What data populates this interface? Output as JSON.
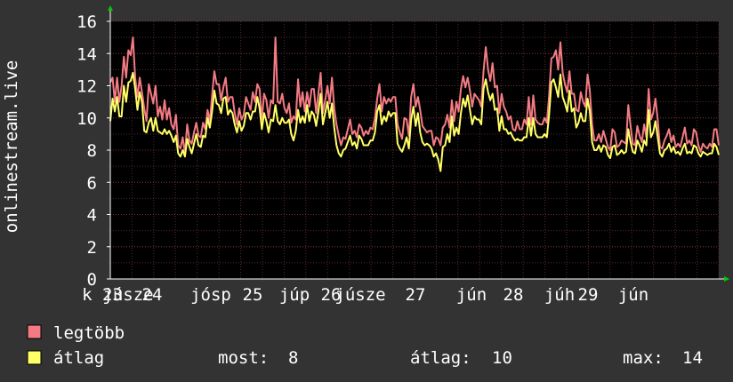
{
  "chart_data": {
    "type": "line",
    "ylabel": "onlinestream.live",
    "ylim": [
      0,
      16
    ],
    "yticks": [
      0,
      2,
      4,
      6,
      8,
      10,
      12,
      14,
      16
    ],
    "grid": true,
    "background_plot": "#000000",
    "background_page": "#333333",
    "x_tick_labels": [
      "k 23",
      "júsze",
      "24",
      "jósp",
      "25",
      "júp",
      "26",
      "júsze",
      "27",
      "jún",
      "28",
      "júh",
      "29",
      "jún"
    ],
    "series": [
      {
        "name": "legtöbb",
        "color": "#f47b84",
        "values": [
          12.2,
          12.5,
          11,
          12.5,
          11,
          12,
          13.8,
          12.5,
          14.2,
          13.9,
          15,
          12.5,
          11.3,
          12.5,
          11.6,
          10.6,
          9.8,
          12.1,
          11.5,
          10.9,
          12,
          10.1,
          10.7,
          9.9,
          11.1,
          9.9,
          10.6,
          9.6,
          9.3,
          10.2,
          8.3,
          8.1,
          8.8,
          7.8,
          9.6,
          8.6,
          8.4,
          9.1,
          9.7,
          8.9,
          8.8,
          9.7,
          9.3,
          10.5,
          9.8,
          11.4,
          12.9,
          12.1,
          12.1,
          11.1,
          11.9,
          12.5,
          11,
          11.3,
          11.3,
          10.3,
          9.6,
          10.6,
          9.9,
          10.2,
          11.3,
          10.9,
          10.5,
          11.6,
          11,
          12.1,
          11.8,
          9.9,
          11.5,
          11.1,
          10,
          11.1,
          10.9,
          15,
          11,
          10.9,
          11.5,
          10.6,
          10.3,
          10.9,
          9.7,
          10.1,
          9.9,
          12.4,
          10.7,
          11.6,
          10.4,
          11.6,
          10.7,
          11.8,
          11.8,
          10.3,
          11.5,
          12.8,
          10.3,
          11.1,
          12,
          10.9,
          12.5,
          10.6,
          9.6,
          8.9,
          8.3,
          8.8,
          8.7,
          9.3,
          9.9,
          9,
          9.2,
          8.8,
          9.6,
          9.4,
          8.9,
          9.2,
          9,
          9.4,
          9.3,
          10,
          11.2,
          12.1,
          10.4,
          11.3,
          10.9,
          11.2,
          11,
          11.3,
          11.3,
          9.6,
          9.1,
          8.7,
          10,
          9.9,
          8.9,
          11.3,
          12.1,
          10.7,
          11.3,
          10.5,
          9.5,
          9.3,
          9.1,
          9.2,
          9.2,
          8.3,
          8.8,
          8.7,
          8.3,
          9.4,
          9.6,
          10.2,
          9.4,
          11.1,
          9.8,
          11,
          10.4,
          11.8,
          12.6,
          11.9,
          12.5,
          11.7,
          10.7,
          11.5,
          11.3,
          11.1,
          10.7,
          12.9,
          14.4,
          13,
          12.3,
          13.4,
          11.9,
          12,
          10.3,
          11.5,
          10.7,
          10.4,
          9.9,
          10.1,
          9.3,
          9.2,
          9.8,
          9.3,
          9.3,
          9.9,
          9.6,
          11.3,
          9.6,
          11.4,
          9.9,
          9.7,
          9.6,
          9.6,
          10,
          9.7,
          11.4,
          13.7,
          13.8,
          14.2,
          13,
          14.7,
          12.8,
          12.1,
          11.6,
          12.9,
          11.5,
          11.5,
          10.5,
          10.4,
          11.6,
          11,
          10.7,
          12.7,
          11.7,
          9.6,
          8.6,
          8.6,
          9,
          8.5,
          9.2,
          8.7,
          8.2,
          8,
          9.3,
          9.1,
          8.2,
          8.3,
          8.6,
          8.5,
          8.4,
          10.8,
          9.5,
          8.4,
          8.3,
          9.5,
          8.9,
          8.5,
          9.6,
          8.8,
          11.8,
          9.9,
          10.3,
          11.2,
          9.9,
          8.2,
          8.1,
          8.6,
          8.9,
          9.3,
          8.5,
          8.9,
          8.2,
          8.4,
          8.2,
          8.8,
          9.4,
          8.4,
          8.6,
          8.3,
          9.3,
          9.1,
          8.3,
          7.9,
          8.4,
          8.2,
          8.1,
          8.4,
          8.2,
          9.3,
          9.3,
          8.3
        ]
      },
      {
        "name": "átlag",
        "color": "#ffff66",
        "values": [
          9.8,
          11.2,
          10.4,
          11.3,
          10.1,
          10.1,
          12,
          11,
          12.2,
          12.3,
          12.8,
          11.8,
          10.5,
          11.6,
          11,
          9.2,
          9.1,
          9.7,
          10,
          9.2,
          10,
          9.2,
          9.1,
          9,
          9.3,
          9,
          9.2,
          8.9,
          8.5,
          8.9,
          7.8,
          7.6,
          8,
          7.6,
          8.7,
          8.2,
          7.8,
          8.4,
          9,
          8.3,
          8.2,
          8.9,
          8.8,
          10,
          9.4,
          10.4,
          11.7,
          10.9,
          10.8,
          10.3,
          11.2,
          11.3,
          10.2,
          10.5,
          10.3,
          9.6,
          9.1,
          9.8,
          9.2,
          9.5,
          10.3,
          10.3,
          9.9,
          10.4,
          10.4,
          11.3,
          10.6,
          9.3,
          10.3,
          9.8,
          9.1,
          9.9,
          9.8,
          10.8,
          9.8,
          9.6,
          10,
          9.7,
          9.7,
          9.9,
          9,
          8.6,
          9.2,
          10.5,
          9.7,
          10.1,
          9.7,
          10.8,
          9.8,
          10.4,
          10.2,
          9.5,
          10.4,
          11.5,
          9.6,
          10.3,
          11,
          10,
          10.9,
          9.4,
          8.3,
          7.8,
          7.6,
          8,
          8.1,
          8.5,
          8.9,
          8.3,
          8.5,
          8.1,
          8.9,
          8.7,
          8.3,
          8.3,
          8.3,
          8.6,
          8.6,
          9.1,
          10.4,
          10.8,
          9.6,
          10.1,
          9.8,
          10.4,
          10.1,
          10.3,
          10.3,
          8.4,
          8.1,
          7.9,
          8.3,
          8.8,
          8.1,
          9.9,
          10.7,
          9.5,
          10.3,
          9.1,
          8.5,
          8.3,
          8.4,
          8.3,
          8.1,
          7.6,
          7.8,
          7.4,
          6.7,
          8.2,
          8.3,
          9,
          8.5,
          10.1,
          8.9,
          9.4,
          9,
          10.3,
          11.2,
          10.7,
          11.4,
          10.5,
          9.6,
          10.1,
          9.9,
          9.9,
          9.6,
          11.8,
          12.4,
          11.6,
          11.1,
          11.5,
          10.5,
          10.6,
          9.2,
          10.1,
          9.3,
          9.3,
          9,
          9.1,
          8.8,
          8.6,
          8.7,
          8.6,
          8.6,
          8.8,
          8.8,
          10,
          8.9,
          10,
          9,
          8.8,
          8.8,
          8.8,
          9,
          8.8,
          10.2,
          12.2,
          12.4,
          11.9,
          11.3,
          12.7,
          11.3,
          10.9,
          10.4,
          11.7,
          10.4,
          10.6,
          9.4,
          9.7,
          10.3,
          9.8,
          9.8,
          11.2,
          10.4,
          8.5,
          8,
          8,
          8.3,
          7.9,
          8.3,
          8.2,
          7.7,
          7.5,
          8.2,
          8.3,
          7.7,
          7.8,
          8,
          7.8,
          7.9,
          9.3,
          8.5,
          7.9,
          7.8,
          8.6,
          8.3,
          7.9,
          8.6,
          8.3,
          10.5,
          8.8,
          9.1,
          9.8,
          8.8,
          7.8,
          7.6,
          8,
          8.1,
          8.4,
          7.9,
          8.2,
          7.8,
          7.9,
          7.7,
          8.1,
          8.4,
          7.8,
          7.9,
          7.8,
          8.3,
          8.2,
          7.8,
          7.6,
          7.9,
          7.8,
          7.7,
          7.8,
          7.8,
          8.4,
          8.2,
          7.7
        ]
      }
    ],
    "legend": [
      {
        "name": "legtöbb",
        "color": "#f47b84"
      },
      {
        "name": "átlag",
        "color": "#ffff66"
      }
    ],
    "stats": {
      "now_label": "most:",
      "now_value": "8",
      "avg_label": "átlag:",
      "avg_value": "10",
      "max_label": "max:",
      "max_value": "14"
    }
  }
}
